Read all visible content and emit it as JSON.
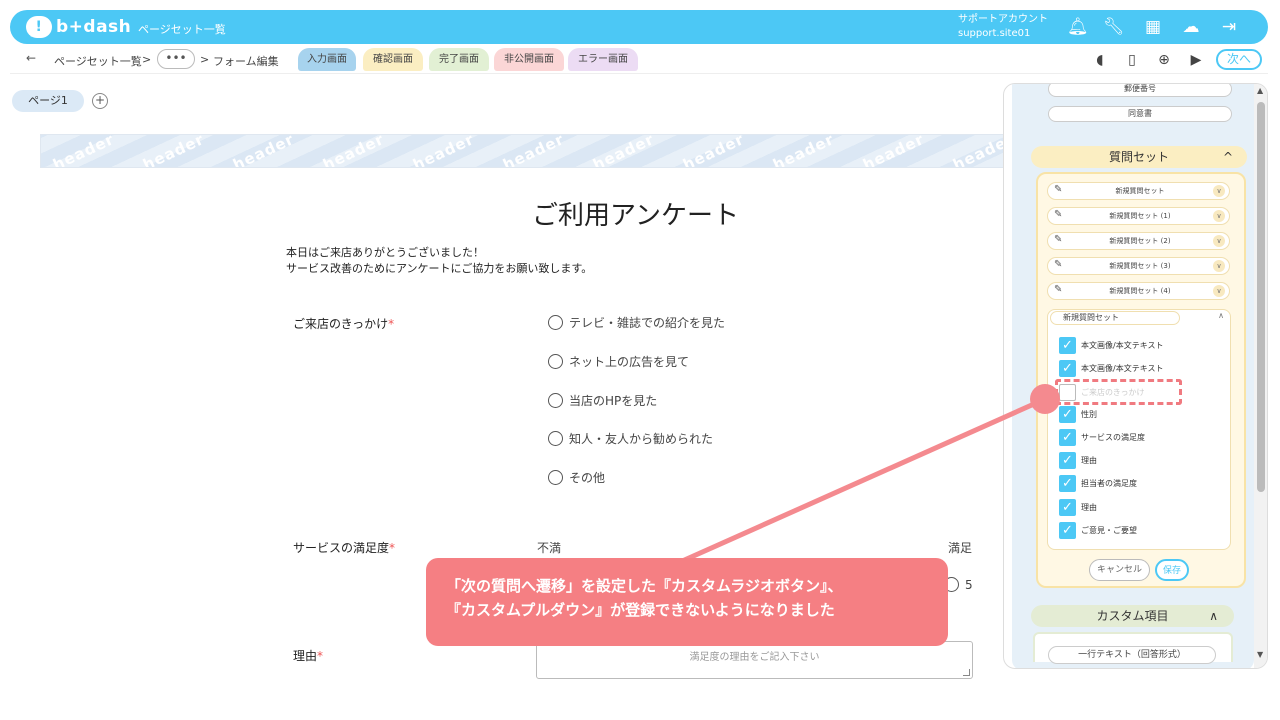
{
  "app": {
    "brand": "b+dash",
    "nav_title": "ページセット一覧"
  },
  "account": {
    "line1": "サポートアカウント",
    "line2": "support.site01"
  },
  "top_icons": [
    "bell-icon",
    "wrench-icon",
    "grid-icon",
    "bot-icon",
    "logout-icon"
  ],
  "breadcrumb": {
    "back": "←",
    "root": "ページセット一覧",
    "sep": ">",
    "dots": "•••",
    "current": "フォーム編集"
  },
  "tabs": [
    {
      "label": "入力画面",
      "color": "#a7d3ee"
    },
    {
      "label": "確認画面",
      "color": "#fbeec2"
    },
    {
      "label": "完了画面",
      "color": "#e2f0d4"
    },
    {
      "label": "非公開画面",
      "color": "#fbd6d6"
    },
    {
      "label": "エラー画面",
      "color": "#ecdcf4"
    }
  ],
  "toolbar": {
    "next_label": "次へ"
  },
  "page_tab": {
    "label": "ページ1",
    "add": "+"
  },
  "header_band": {
    "word": "header"
  },
  "form": {
    "title": "ご利用アンケート",
    "intro_line1": "本日はご来店ありがとうございました！",
    "intro_line2": "サービス改善のためにアンケートにご協力をお願い致します。",
    "required_mark": "*",
    "q1": {
      "label": "ご来店のきっかけ",
      "options": [
        "テレビ・雑誌での紹介を見た",
        "ネット上の広告を見て",
        "当店のHPを見た",
        "知人・友人から勧められた",
        "その他"
      ]
    },
    "q2": {
      "label": "サービスの満足度",
      "low": "不満",
      "high": "満足",
      "last": "5"
    },
    "q3": {
      "label": "理由",
      "placeholder": "満足度の理由をご記入下さい"
    }
  },
  "panel": {
    "top_pills": [
      "郵便番号",
      "同意書"
    ],
    "question_set": {
      "title": "質問セット",
      "collapse": "^",
      "sets": [
        "新規質問セット",
        "新規質問セット (1)",
        "新規質問セット (2)",
        "新規質問セット (3)",
        "新規質問セット (4)"
      ],
      "open_set": {
        "name": "新規質問セット",
        "items": [
          {
            "label": "本文画像/本文テキスト",
            "checked": true
          },
          {
            "label": "本文画像/本文テキスト",
            "checked": true
          },
          {
            "label": "ご来店のきっかけ",
            "checked": false
          },
          {
            "label": "性別",
            "checked": true
          },
          {
            "label": "サービスの満足度",
            "checked": true
          },
          {
            "label": "理由",
            "checked": true
          },
          {
            "label": "担当者の満足度",
            "checked": true
          },
          {
            "label": "理由",
            "checked": true
          },
          {
            "label": "ご意見・ご要望",
            "checked": true
          }
        ]
      },
      "cancel": "キャンセル",
      "save": "保存"
    },
    "custom": {
      "title": "カスタム項目",
      "first_item": "一行テキスト（回答形式）"
    }
  },
  "callout": {
    "line1": "「次の質問へ遷移」を設定した『カスタムラジオボタン』、",
    "line2": "『カスタムプルダウン』が登録できないようになりました"
  },
  "colors": {
    "brand": "#4cc8f5",
    "callout": "#f57f83",
    "required": "#e55555"
  }
}
